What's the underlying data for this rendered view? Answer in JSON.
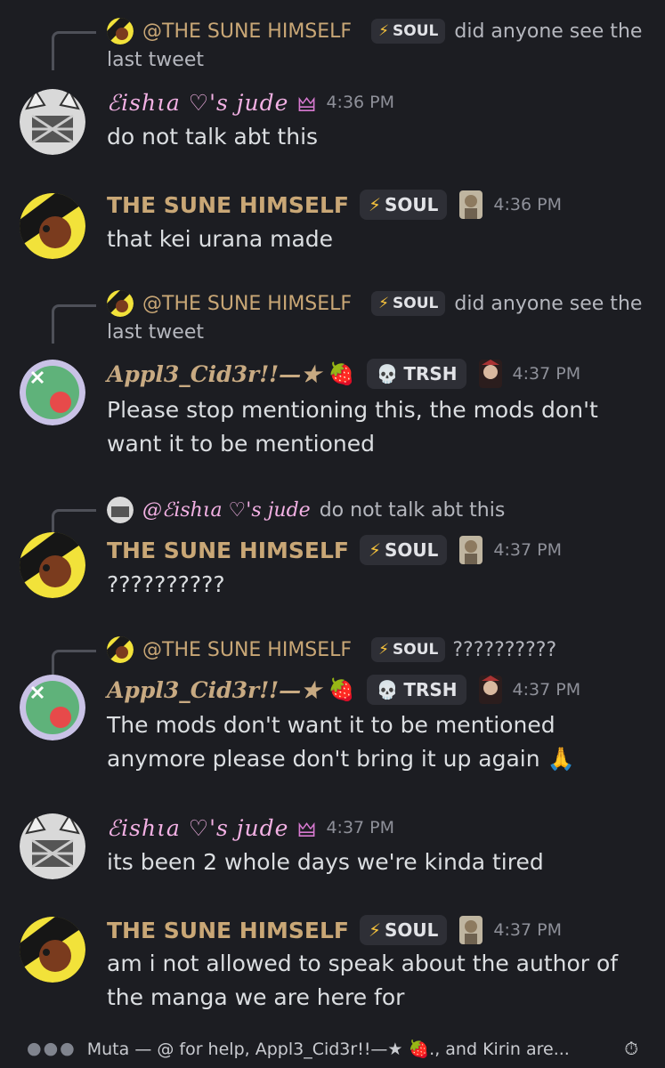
{
  "messages": [
    {
      "reply": {
        "name": "@THE SUNE HIMSELF",
        "tag": "SOUL",
        "text": "did anyone see the",
        "text_wrap": "last tweet"
      },
      "name": "ℰishιa  ♡'s  jude",
      "time": "4:36 PM",
      "tag": null,
      "lines": [
        "do not talk abt this"
      ]
    },
    {
      "name": "THE SUNE HIMSELF",
      "tag": "SOUL",
      "time": "4:36 PM",
      "lines": [
        "that kei urana made"
      ]
    },
    {
      "reply": {
        "name": "@THE SUNE HIMSELF",
        "tag": "SOUL",
        "text": "did anyone see the",
        "text_wrap": "last tweet"
      },
      "name": "Appl3_Cid3r!!—★",
      "tag": "TRSH",
      "time": "4:37 PM",
      "lines": [
        "Please stop mentioning this, the mods don't",
        "want it to be mentioned"
      ]
    },
    {
      "reply": {
        "name": "@ℰishιa  ♡'s  jude",
        "text": "do not talk abt this"
      },
      "name": "THE SUNE HIMSELF",
      "tag": "SOUL",
      "time": "4:37 PM",
      "lines": [
        "??????????"
      ]
    },
    {
      "reply": {
        "name": "@THE SUNE HIMSELF",
        "tag": "SOUL",
        "text": "??????????"
      },
      "name": "Appl3_Cid3r!!—★",
      "tag": "TRSH",
      "time": "4:37 PM",
      "lines": [
        "The mods don't want it to be mentioned",
        "anymore please don't bring it up again 🙏"
      ]
    },
    {
      "name": "ℰishιa  ♡'s  jude",
      "time": "4:37 PM",
      "lines": [
        "its been 2 whole days we're kinda tired"
      ]
    },
    {
      "name": "THE SUNE HIMSELF",
      "tag": "SOUL",
      "time": "4:37 PM",
      "lines": [
        "am i not allowed to speak about the author of",
        "the manga we are here for"
      ]
    }
  ],
  "footer": {
    "text": "Muta — @ for help, Appl3_Cid3r!!—★ 🍓., and Kirin are...",
    "dots": "●●●",
    "timer_icon": "timer-icon"
  },
  "colors": {
    "background": "#1c1d22",
    "name_gold": "#c9a776",
    "name_pink": "#f3b1e4",
    "bolt": "#f6c23c"
  }
}
